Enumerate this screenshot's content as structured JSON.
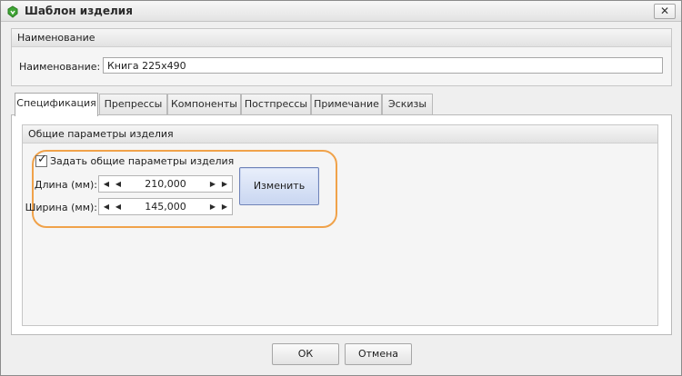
{
  "window": {
    "title": "Шаблон изделия",
    "close_glyph": "✕"
  },
  "name_group": {
    "header": "Наименование",
    "label": "Наименование:",
    "value": "Книга 225x490"
  },
  "tabs": [
    {
      "label": "Спецификация",
      "active": true
    },
    {
      "label": "Препрессы"
    },
    {
      "label": "Компоненты"
    },
    {
      "label": "Постпрессы"
    },
    {
      "label": "Примечание"
    },
    {
      "label": "Эскизы"
    }
  ],
  "params": {
    "header": "Общие параметры изделия",
    "checkbox_label": "Задать общие параметры изделия",
    "checked": true,
    "length": {
      "label": "Длина (мм):",
      "value": "210,000"
    },
    "width": {
      "label": "Ширина (мм):",
      "value": "145,000"
    },
    "change_button": "Изменить"
  },
  "footer": {
    "ok": "ОК",
    "cancel": "Отмена"
  },
  "colors": {
    "highlight": "#f0a24a",
    "accent_button": "#c9d6f1",
    "app_icon": "#3fa535"
  }
}
